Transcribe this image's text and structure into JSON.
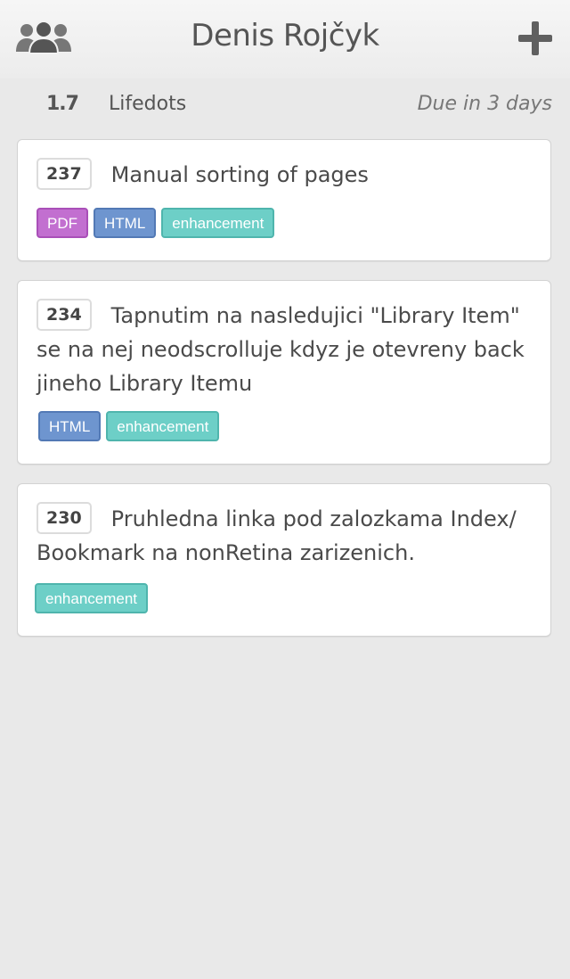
{
  "header": {
    "title": "Denis Rojčyk",
    "left_icon": "team-icon",
    "right_icon": "add-icon"
  },
  "milestone": {
    "version": "1.7",
    "name": "Lifedots",
    "due": "Due in 3 days"
  },
  "issues": [
    {
      "number": "237",
      "title": "Manual sorting of pages",
      "labels": [
        "PDF",
        "HTML",
        "enhancement"
      ]
    },
    {
      "number": "234",
      "title": "Tapnutim na nasledujici \"Library Item\" se na nej neodscrolluje kdyz je otevreny back jineho Library Itemu",
      "labels": [
        "HTML",
        "enhancement"
      ]
    },
    {
      "number": "230",
      "title": "Pruhledna linka pod zalozkama Index/ Bookmark na nonRetina zarizenich.",
      "labels": [
        "enhancement"
      ]
    }
  ],
  "colors": {
    "pdf": "#c26fd0",
    "html": "#6e95cf",
    "enhancement": "#6dcfc7",
    "icon": "#666666"
  }
}
